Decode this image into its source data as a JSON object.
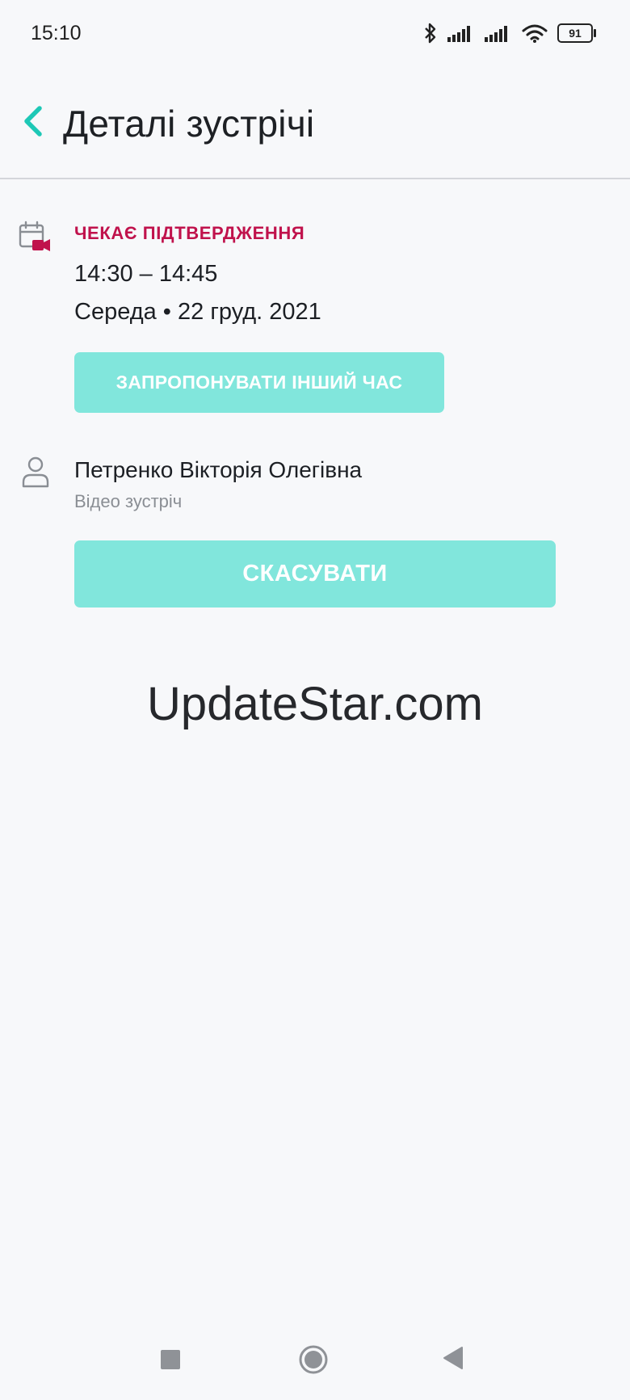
{
  "status_bar": {
    "time": "15:10",
    "battery": "91",
    "icons": [
      "bluetooth-icon",
      "signal-icon",
      "signal-icon",
      "wifi-icon",
      "battery-icon"
    ]
  },
  "header": {
    "title": "Деталі зустрічі",
    "back_icon": "chevron-left-icon"
  },
  "appointment": {
    "icon": "calendar-video-icon",
    "status": "ЧЕКАЄ ПІДТВЕРДЖЕННЯ",
    "time_range": "14:30 – 14:45",
    "date": "Середа • 22 груд. 2021",
    "propose_button": "ЗАПРОПОНУВАТИ ІНШИЙ ЧАС"
  },
  "doctor": {
    "icon": "person-icon",
    "name": "Петренко Вікторія Олегівна",
    "meeting_type": "Відео зустріч"
  },
  "cancel_button": "СКАСУВАТИ",
  "watermark": "UpdateStar.com",
  "colors": {
    "accent": "#1ec8b6",
    "button": "#81e6dc",
    "status": "#c0124c",
    "background": "#f7f8fa"
  }
}
